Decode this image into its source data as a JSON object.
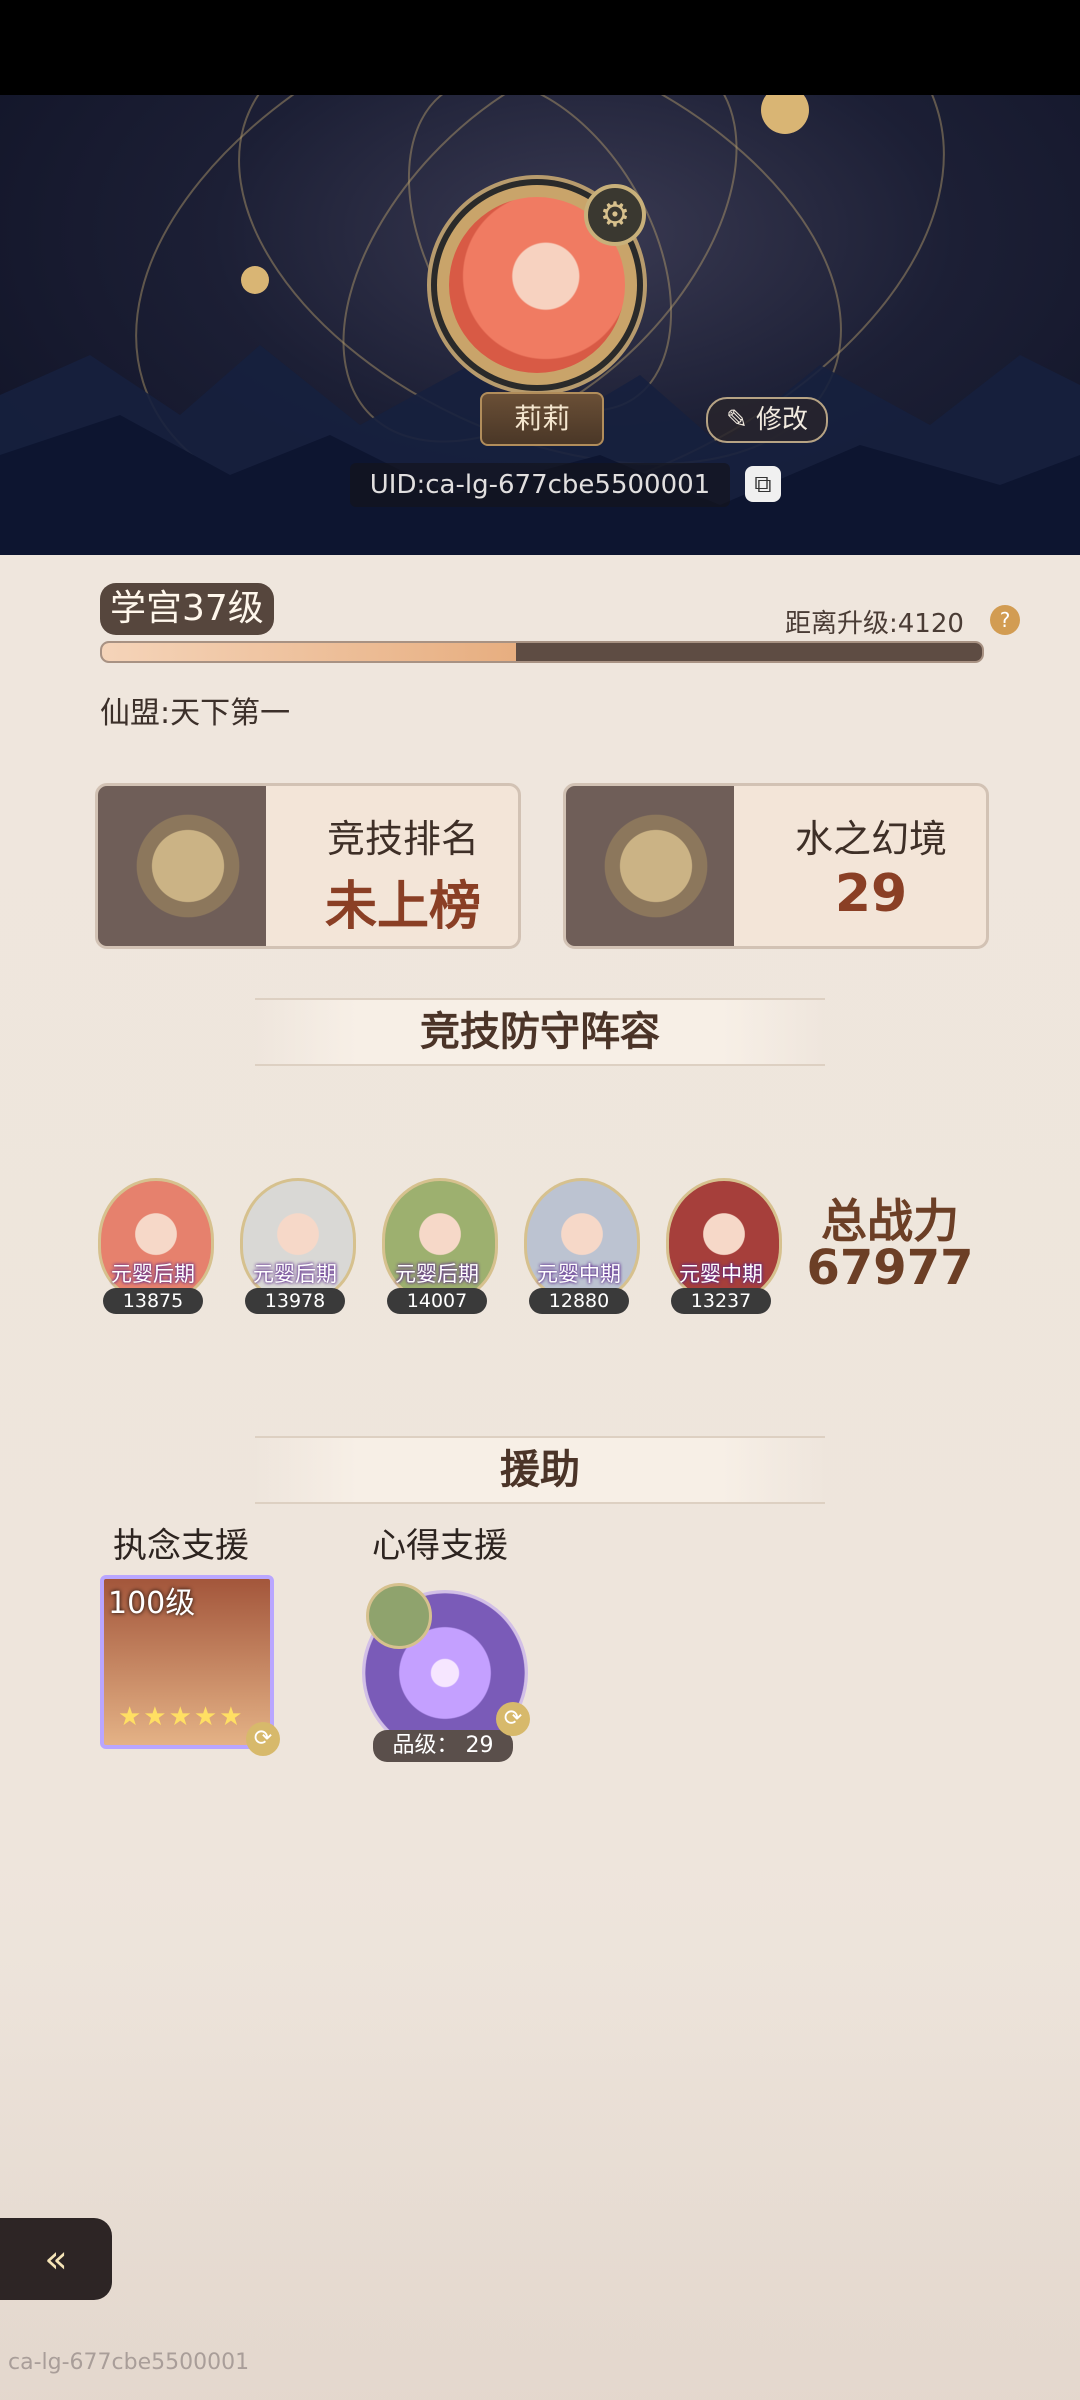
{
  "profile": {
    "name": "莉莉",
    "edit_label": "修改",
    "uid": "UID:ca-lg-677cbe5500001",
    "level_label": "学宫37级",
    "distance_label": "距离升级:4120",
    "exp_progress": 0.47,
    "guild": "仙盟:天下第一"
  },
  "stats_cards": [
    {
      "title": "竞技排名",
      "value": "未上榜"
    },
    {
      "title": "水之幻境",
      "value": "29"
    }
  ],
  "defense": {
    "section_title": "竞技防守阵容",
    "heroes": [
      {
        "stage": "元婴后期",
        "power": "13875",
        "color": "#e6816d"
      },
      {
        "stage": "元婴后期",
        "power": "13978",
        "color": "#d9d8d5"
      },
      {
        "stage": "元婴后期",
        "power": "14007",
        "color": "#9db06f"
      },
      {
        "stage": "元婴中期",
        "power": "12880",
        "color": "#bcc3d1"
      },
      {
        "stage": "元婴中期",
        "power": "13237",
        "color": "#a63f3b"
      }
    ],
    "total_power_label": "总战力",
    "total_power_value": "67977"
  },
  "assist": {
    "section_title": "援助",
    "obsession_label": "执念支援",
    "insight_label": "心得支援",
    "obsession_level": "100级",
    "stars": "★★★★★",
    "grade_label": "品级： 29"
  },
  "watermark": "ca-lg-677cbe5500001",
  "icons": {
    "gear": "gear-icon",
    "edit": "pencil-icon",
    "copy": "copy-icon",
    "help": "question-icon",
    "back": "back-arrow-icon"
  }
}
